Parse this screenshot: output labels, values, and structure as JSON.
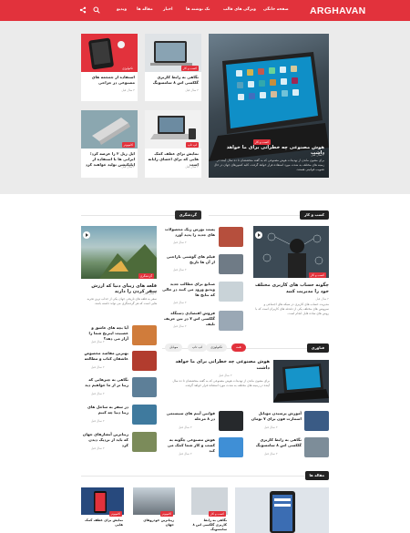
{
  "header": {
    "logo": "ARGHAVAN",
    "nav": [
      "صفحه خانگی",
      "ویژگی های قالب",
      "تک نوشته ها",
      "اخبار",
      "مقاله ها",
      "ویدیو"
    ]
  },
  "hero": {
    "badge": "کسب و کار",
    "title": "هوش مصنوعی چه خطراتی برای ما خواهد داشت",
    "meta": "۲ سال قبل",
    "excerpt": "برای مصون ماندن از تهدیدات هوش مصنوعی که به گفته متخصصان تا ده سال آینده در زمینه های مختلف به شدت مورد استفاده قرار خواهد گرفت، کلیه کشورهای جهان در حال تصویب قوانینی هستند."
  },
  "top_cards": [
    {
      "badge": "کسب و کار",
      "title": "نگاهی به رابط کاربری گلکسی اس ۸ سامسونگ",
      "meta": "۲ سال قبل"
    },
    {
      "badge": "تکنولوژی",
      "title": "استفاده از جمجمه های مصنوعی در جراحی",
      "meta": "۲ سال قبل"
    },
    {
      "badge": "لپ تاپ",
      "title": "نمایش برای عطف کمک هایی که برای اعضای رایانه است",
      "meta": "۲ سال قبل"
    },
    {
      "badge": "کامپیوتر",
      "title": "اپل ریل ۲ را عرضه کرد؛ ایرانی ها با استفاده از اپلیکیشن تولید خواهند کرد",
      "meta": "۲ سال قبل"
    }
  ],
  "sections": {
    "business": "کسب و کار",
    "travel": "گردشگری",
    "tech": "فناوری",
    "articles": "مقاله ها"
  },
  "business_main": {
    "badge": "کسب و کار",
    "title": "چگونه حساب های کاربری مختلف خود را مدیریت کنید",
    "meta": "۲ سال قبل",
    "excerpt": "مدیریت حساب های کاربری در شبکه های اجتماعی و سرویس های مختلف یکی از دغدغه های کاربران است که با روش های ساده قابل انجام است."
  },
  "business_list": [
    {
      "title": "پست بورس ریک محصولات های جدید را پدید آورد",
      "meta": "۲ سال قبل"
    },
    {
      "title": "فیلم های گوشتی ناراحتی از آن ها تاریخ",
      "meta": "۲ سال قبل"
    },
    {
      "title": "صنایع برای مطالب جدید ویدیو ورود می کنند در حالی که نتایج ها",
      "meta": "۲ سال قبل"
    },
    {
      "title": "فروش اقتصادی دستگاه گلکسی اس ۷ در بین حریف تلیف",
      "meta": "۲ سال قبل"
    }
  ],
  "travel_main": {
    "badge": "گردشگری",
    "title": "قلعه های زیبای دنیا که ارزش سفر کردن را دارند",
    "meta": "۲ سال قبل",
    "excerpt": "سفر به قلعه های تاریخی جهان یکی از جذاب ترین تجربه هایی است که هر گردشگری می تواند داشته باشد."
  },
  "travel_list": [
    {
      "title": "آیا بچه های عاشق و عصبیت اینرنج شما را آزار می دهد؟",
      "meta": "۲ سال قبل"
    },
    {
      "title": "بهترین مقاصد مخصوص عاشقان کتاب و مطالعه",
      "meta": "۲ سال قبل"
    },
    {
      "title": "نگاهی به چیزهایی که زیبا تر از ما خواهیم دید",
      "meta": "۲ سال قبل"
    },
    {
      "title": "در سفر به ساحل های زیبا دنیا چه کنیم",
      "meta": "۲ سال قبل"
    },
    {
      "title": "زیباترین آبشارهای جهان که باید از نزدیک دیدن کرد",
      "meta": "۲ سال قبل"
    }
  ],
  "tech": {
    "tabs": [
      "همه",
      "تکنولوژی",
      "لپ تاپ",
      "موبایل"
    ],
    "main": {
      "title": "هوش مصنوعی چه خطراتی برای ما خواهد داشت",
      "meta": "۲ سال قبل",
      "excerpt": "برای مصون ماندن از تهدیدات هوش مصنوعی که به گفته متخصصان تا ده سال آینده در زمینه های مختلف به شدت مورد استفاده قرار خواهد گرفت."
    },
    "list": [
      {
        "title": "آموزش پرسیدن موبایل اسمارت فون برای ۷ تومان",
        "meta": "۲ سال قبل"
      },
      {
        "title": "قوانین آیتم های سیستمی در ۸ مرحله",
        "meta": "۲ سال قبل"
      },
      {
        "title": "نگاهی به رابط کاربری گلکسی اس ۸ سامسونگ",
        "meta": "۲ سال قبل"
      },
      {
        "title": "هوش مصنوعی چگونه به کسب و کار شما کمک می کند",
        "meta": "۲ سال قبل"
      }
    ]
  },
  "articles": [
    {
      "badge": "کسب و کار",
      "title": "نگاهی به رابط کاربری گلکسی اس ۸ سامسونگ"
    },
    {
      "badge": "کامپیوتر",
      "title": "زیباترین خودروهای جهان"
    },
    {
      "badge": "کامپیوتر",
      "title": "نمایش برای عطف کمک هایی"
    },
    {
      "badge": "تکنولوژی",
      "title": "استفاده از جمجمه های مصنوعی"
    }
  ]
}
